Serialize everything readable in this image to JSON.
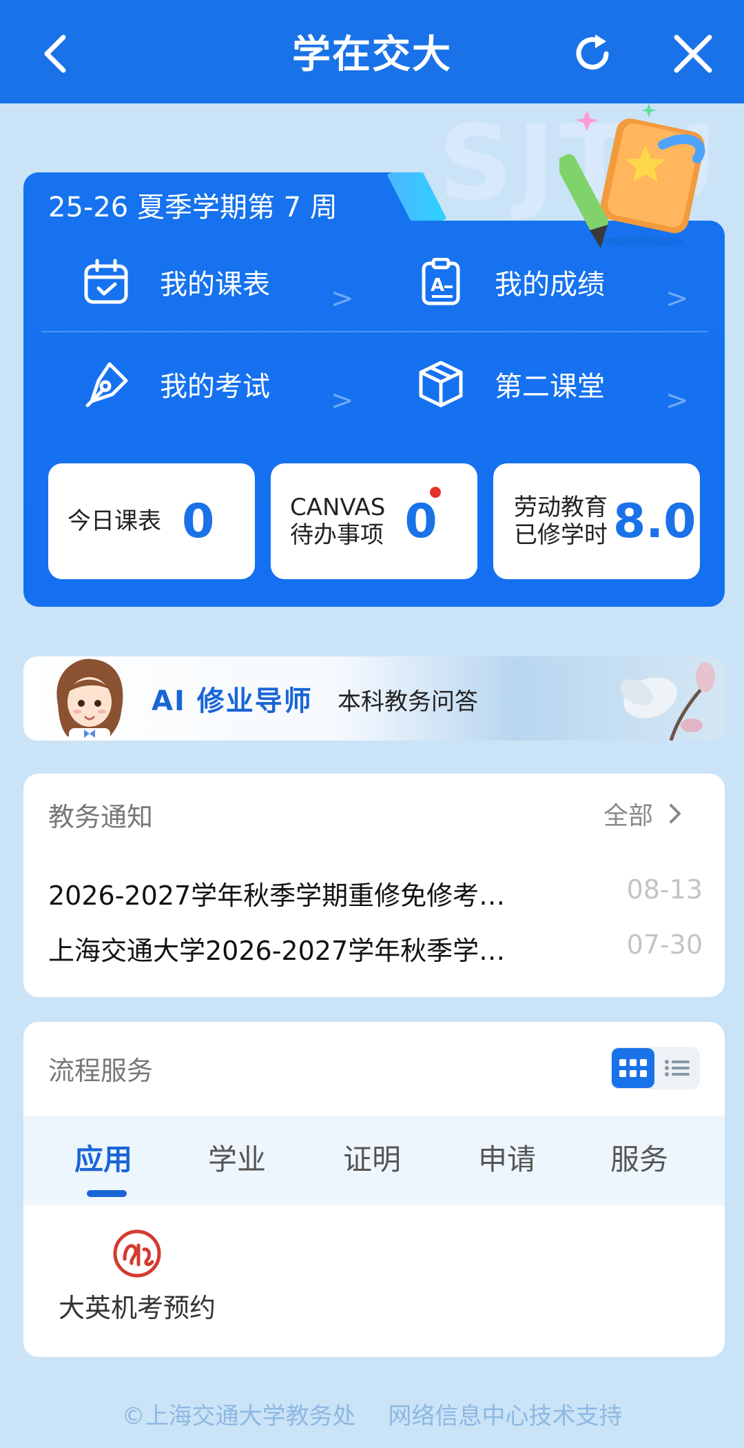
{
  "header": {
    "title": "学在交大"
  },
  "watermark": {
    "text": "SJTU"
  },
  "semester": {
    "label": "25-26 夏季学期第 7 周"
  },
  "menu": [
    {
      "label": "我的课表",
      "icon": "calendar-icon"
    },
    {
      "label": "我的成绩",
      "icon": "clipboard-grade-icon"
    },
    {
      "label": "我的考试",
      "icon": "pen-nib-icon"
    },
    {
      "label": "第二课堂",
      "icon": "cube-icon"
    }
  ],
  "chevron": ">",
  "stats": {
    "today": {
      "label": "今日课表",
      "value": "0"
    },
    "canvas": {
      "label1": "CANVAS",
      "label2": "待办事项",
      "value": "0"
    },
    "labor": {
      "label1": "劳动教育",
      "label2": "已修学时",
      "value": "8.0"
    }
  },
  "ai": {
    "title": "AI 修业导师",
    "subtitle": "本科教务问答"
  },
  "notices": {
    "title": "教务通知",
    "all": "全部",
    "items": [
      {
        "title": "2026-2027学年秋季学期重修免修考…",
        "date": "08-13"
      },
      {
        "title": "上海交通大学2026-2027学年秋季学…",
        "date": "07-30"
      }
    ]
  },
  "flow": {
    "title": "流程服务",
    "tabs": [
      "应用",
      "学业",
      "证明",
      "申请",
      "服务"
    ],
    "apps": [
      {
        "label": "大英机考预约",
        "icon": "exam-seal-icon"
      }
    ]
  },
  "footer": {
    "left": "©上海交通大学教务处",
    "right": "网络信息中心技术支持"
  },
  "colors": {
    "primary": "#1a72e8",
    "background": "#cbe3f7",
    "notification_dot": "#e5312a"
  }
}
